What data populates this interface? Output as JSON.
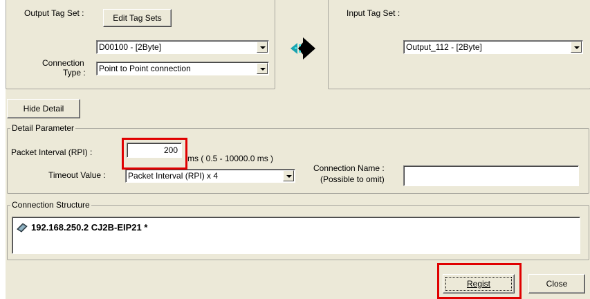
{
  "output": {
    "tag_set_label": "Output Tag Set :",
    "edit_button": "Edit Tag Sets",
    "tag_set_value": "D00100 - [2Byte]",
    "connection_type_label_1": "Connection",
    "connection_type_label_2": "Type :",
    "connection_type_value": "Point to Point connection"
  },
  "input": {
    "tag_set_label": "Input Tag Set :",
    "tag_set_value": "Output_112 - [2Byte]"
  },
  "hide_detail_button": "Hide Detail",
  "detail": {
    "title": "Detail Parameter",
    "rpi_label": "Packet Interval (RPI) :",
    "rpi_value": "200",
    "rpi_range": "ms ( 0.5 - 10000.0 ms )",
    "timeout_label": "Timeout Value :",
    "timeout_value": "Packet Interval (RPI) x 4",
    "conn_name_label_1": "Connection Name :",
    "conn_name_label_2": "(Possible to omit)",
    "conn_name_value": ""
  },
  "structure": {
    "title": "Connection Structure",
    "item": "192.168.250.2 CJ2B-EIP21 *"
  },
  "footer": {
    "regist_button": "Regist",
    "close_button": "Close"
  },
  "colors": {
    "highlight": "#e00000",
    "dialog_bg": "#ece9d8"
  }
}
